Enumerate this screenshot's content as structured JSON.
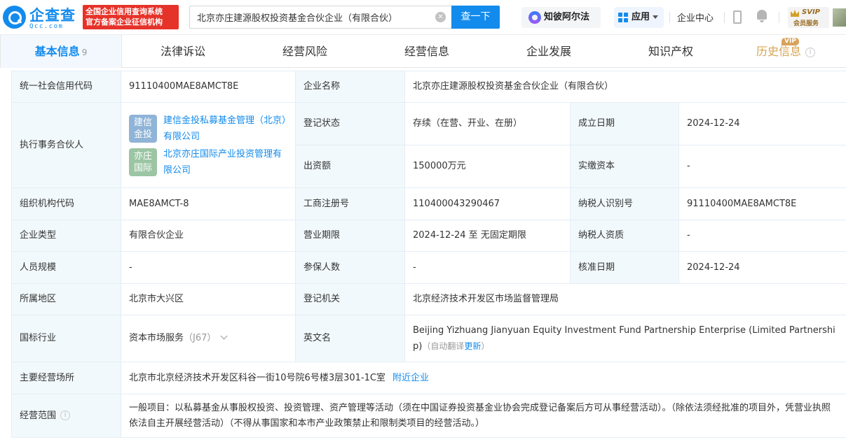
{
  "header": {
    "logo_name": "企查查",
    "logo_sub": "Qcc.com",
    "banner_line1": "全国企业信用查询系统",
    "banner_line2": "官方备案企业征信机构",
    "search_value": "北京亦庄建源股权投资基金合伙企业（有限合伙）",
    "search_button": "查一下",
    "zhibo_label": "知彼阿尔法",
    "apps_label": "应用",
    "center_label": "企业中心",
    "svip_title": "SVIP",
    "svip_sub": "会员服务"
  },
  "tabs": [
    {
      "label": "基本信息",
      "count": "9"
    },
    {
      "label": "法律诉讼"
    },
    {
      "label": "经营风险"
    },
    {
      "label": "经营信息"
    },
    {
      "label": "企业发展"
    },
    {
      "label": "知识产权"
    },
    {
      "label": "历史信息",
      "badge": "VIP"
    }
  ],
  "info": {
    "credit_code": {
      "label": "统一社会信用代码",
      "value": "91110400MAE8AMCT8E"
    },
    "company_name": {
      "label": "企业名称",
      "value": "北京亦庄建源股权投资基金合伙企业（有限合伙）"
    },
    "partner_label": "执行事务合伙人",
    "partners": [
      {
        "logo": [
          "建信",
          "金投"
        ],
        "name": "建信金投私募基金管理（北京）有限公司",
        "color": "#8fb4d7"
      },
      {
        "logo": [
          "亦庄",
          "国际"
        ],
        "name": "北京亦庄国际产业投资管理有限公司",
        "color": "#9cc5a4"
      }
    ],
    "reg_status": {
      "label": "登记状态",
      "value": "存续（在营、开业、在册）"
    },
    "found_date": {
      "label": "成立日期",
      "value": "2024-12-24"
    },
    "capital": {
      "label": "出资额",
      "value": "150000万元"
    },
    "paid_capital": {
      "label": "实缴资本",
      "value": "-"
    },
    "org_code": {
      "label": "组织机构代码",
      "value": "MAE8AMCT-8"
    },
    "reg_no": {
      "label": "工商注册号",
      "value": "110400043290467"
    },
    "taxpayer_id": {
      "label": "纳税人识别号",
      "value": "91110400MAE8AMCT8E"
    },
    "company_type": {
      "label": "企业类型",
      "value": "有限合伙企业"
    },
    "term": {
      "label": "营业期限",
      "value": "2024-12-24 至 无固定期限"
    },
    "taxpayer_qual": {
      "label": "纳税人资质",
      "value": "-"
    },
    "staff_size": {
      "label": "人员规模",
      "value": "-"
    },
    "insured": {
      "label": "参保人数",
      "value": "-"
    },
    "approve_date": {
      "label": "核准日期",
      "value": "2024-12-24"
    },
    "region": {
      "label": "所属地区",
      "value": "北京市大兴区"
    },
    "reg_authority": {
      "label": "登记机关",
      "value": "北京经济技术开发区市场监督管理局"
    },
    "industry": {
      "label": "国标行业",
      "value": "资本市场服务",
      "code": "（J67）"
    },
    "english_name": {
      "label": "英文名",
      "value": "Beijing Yizhuang Jianyuan Equity Investment Fund Partnership Enterprise (Limited Partnership)",
      "auto_note": "（自动翻译",
      "update_link": "更新",
      "close_paren": "）"
    },
    "address": {
      "label": "主要经营场所",
      "value": "北京市北京经济技术开发区科谷一街10号院6号楼3层301-1C室",
      "nearby_link": "附近企业"
    },
    "scope": {
      "label": "经营范围",
      "value": "一般项目：以私募基金从事股权投资、投资管理、资产管理等活动（须在中国证券投资基金业协会完成登记备案后方可从事经营活动）。（除依法须经批准的项目外，凭营业执照依法自主开展经营活动）（不得从事国家和本市产业政策禁止和限制类项目的经营活动。）"
    }
  }
}
